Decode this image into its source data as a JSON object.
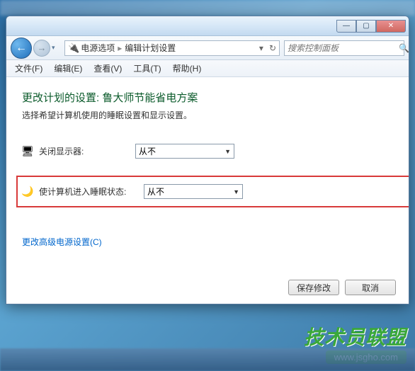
{
  "window": {
    "controls": {
      "min": "—",
      "max": "▢",
      "close": "✕"
    }
  },
  "nav": {
    "back": "←",
    "fwd": "→",
    "drop": "▾",
    "breadcrumb": {
      "icon": "🔌",
      "part1": "电源选项",
      "sep": "▸",
      "part2": "编辑计划设置",
      "end_sep": "▾",
      "refresh": "↻"
    },
    "search_placeholder": "搜索控制面板",
    "search_icon": "🔍"
  },
  "menu": {
    "items": [
      "文件(F)",
      "编辑(E)",
      "查看(V)",
      "工具(T)",
      "帮助(H)"
    ]
  },
  "page": {
    "title": "更改计划的设置: 鲁大师节能省电方案",
    "subtitle": "选择希望计算机使用的睡眠设置和显示设置。"
  },
  "settings": {
    "display_off": {
      "icon": "🖥",
      "label": "关闭显示器:",
      "value": "从不"
    },
    "sleep": {
      "icon": "🌙",
      "label": "使计算机进入睡眠状态:",
      "value": "从不"
    }
  },
  "link_advanced": "更改高级电源设置(C)",
  "buttons": {
    "save": "保存修改",
    "cancel": "取消"
  },
  "watermark": {
    "text": "技术员联盟",
    "url": "www.jsgho.com"
  }
}
